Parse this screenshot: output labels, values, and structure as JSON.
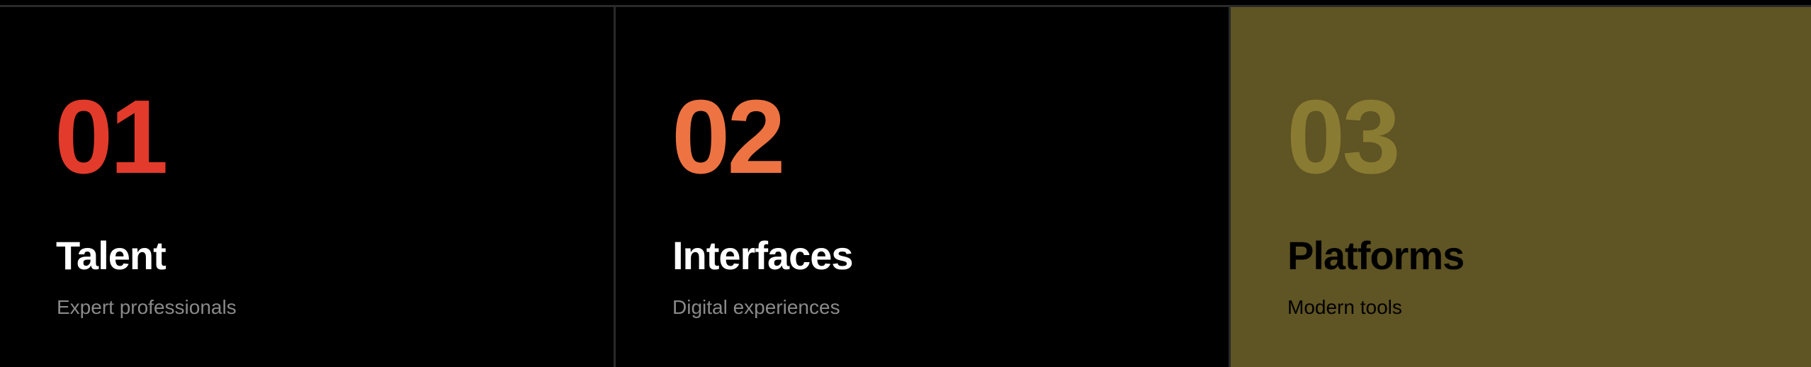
{
  "colors": {
    "background": "#000000",
    "divider": "#2a2a2a",
    "highlight_card": "#5f5423"
  },
  "cards": [
    {
      "number": "01",
      "title": "Talent",
      "subtitle": "Expert professionals",
      "number_color": "#e23b2b",
      "title_color": "#ffffff",
      "subtitle_color": "#8a8a8a"
    },
    {
      "number": "02",
      "title": "Interfaces",
      "subtitle": "Digital experiences",
      "number_color": "#ee7343",
      "title_color": "#ffffff",
      "subtitle_color": "#8a8a8a"
    },
    {
      "number": "03",
      "title": "Platforms",
      "subtitle": "Modern tools",
      "number_color": "#8a7b33",
      "title_color": "#000000",
      "subtitle_color": "#000000"
    }
  ]
}
